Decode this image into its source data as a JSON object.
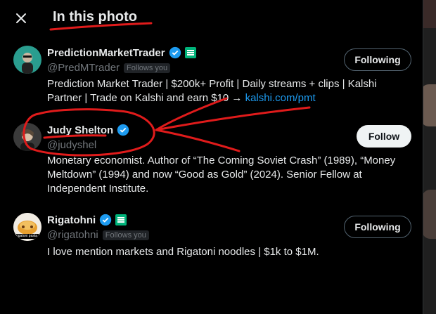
{
  "header": {
    "title": "In this photo",
    "close_label": "×"
  },
  "people": [
    {
      "name": "PredictionMarketTrader",
      "handle": "@PredMTrader",
      "follows_you": "Follows you",
      "button": "Following",
      "bio_text": "Prediction Market Trader | $200k+ Profit | Daily streams + clips | Kalshi Partner | Trade on Kalshi and earn $10 → ",
      "bio_link": "kalshi.com/pmt"
    },
    {
      "name": "Judy Shelton",
      "handle": "@judyshel",
      "button": "Follow",
      "bio_text": "Monetary economist. Author of “The Coming Soviet Crash” (1989), “Money Meltdown” (1994) and now “Good as Gold” (2024). Senior Fellow at Independent Institute."
    },
    {
      "name": "Rigatohni",
      "handle": "@rigatohni",
      "follows_you": "Follows you",
      "button": "Following",
      "bio_text": "I love mention markets and Rigatoni noodles | $1k to $1M.",
      "avatar_text": "rigatoni pasta"
    }
  ],
  "colors": {
    "verified": "#1d9bf0",
    "affiliate": "#00b37a",
    "annotation": "#e01b1b"
  }
}
